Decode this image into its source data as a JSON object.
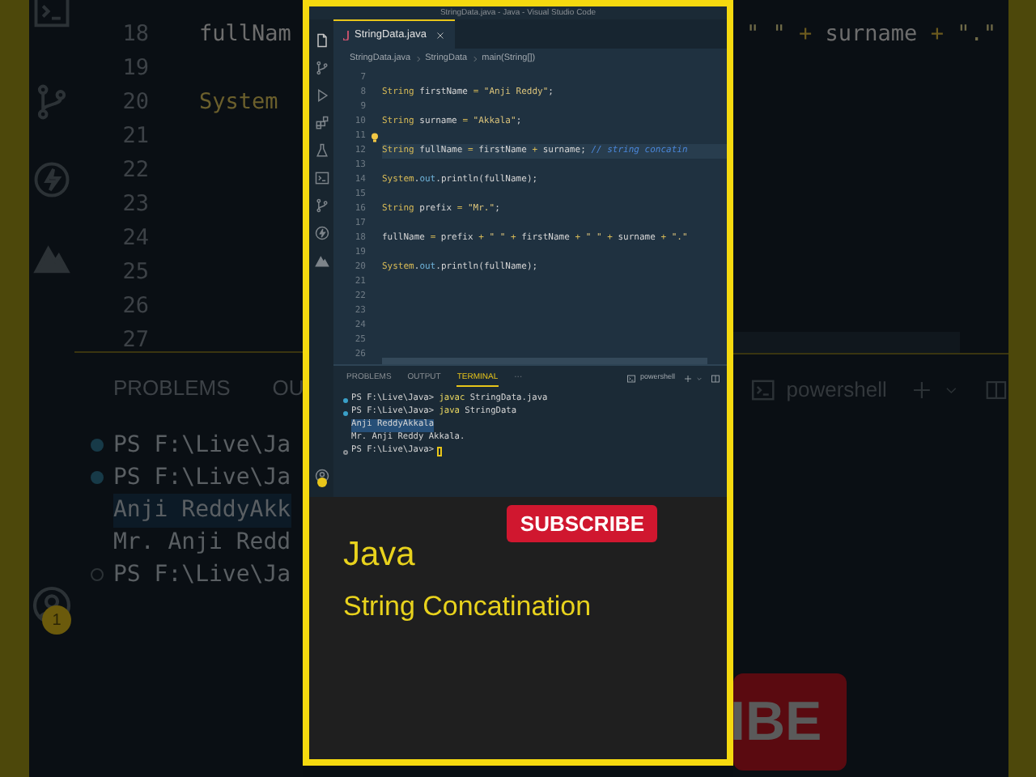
{
  "background": {
    "editor_rows": [
      {
        "number": "18",
        "left_text": "fullNam",
        "right_tokens": [
          {
            "kind": "str",
            "text": "\" \""
          },
          {
            "kind": "op",
            "text": " + "
          },
          {
            "kind": "var",
            "text": "surname"
          },
          {
            "kind": "op",
            "text": " + "
          },
          {
            "kind": "str",
            "text": "\".\""
          }
        ]
      },
      {
        "number": "19"
      },
      {
        "number": "20",
        "left_text": "System"
      },
      {
        "number": "21"
      },
      {
        "number": "22"
      },
      {
        "number": "23"
      },
      {
        "number": "24"
      },
      {
        "number": "25"
      },
      {
        "number": "26"
      },
      {
        "number": "27"
      }
    ],
    "panel_tabs": [
      "PROBLEMS",
      "OU"
    ],
    "shell_label": "powershell",
    "terminal_lines": [
      {
        "kind": "done",
        "text": "PS F:\\Live\\Ja"
      },
      {
        "kind": "done",
        "text": "PS F:\\Live\\Ja"
      },
      {
        "kind": "output",
        "text": "Anji ReddyAkk",
        "selected": true
      },
      {
        "kind": "output",
        "text": "Mr. Anji Redd",
        "selected": false
      },
      {
        "kind": "waiting",
        "text": "PS F:\\Live\\Ja"
      }
    ],
    "badge": "1",
    "subscribe_fragment": "IBE"
  },
  "window": {
    "title": "StringData.java - Java - Visual Studio Code"
  },
  "tabs": [
    {
      "label": "StringData.java",
      "selected": true
    }
  ],
  "breadcrumbs": [
    "StringData.java",
    "StringData",
    "main(String[])"
  ],
  "code_lines": [
    {
      "number": "7"
    },
    {
      "number": "8",
      "tokens": [
        {
          "kind": "type",
          "text": "String"
        },
        {
          "kind": "var",
          "text": " firstName "
        },
        {
          "kind": "op",
          "text": "="
        },
        {
          "kind": "str",
          "text": " \"Anji Reddy\""
        },
        {
          "kind": "punct",
          "text": ";"
        }
      ]
    },
    {
      "number": "9"
    },
    {
      "number": "10",
      "tokens": [
        {
          "kind": "type",
          "text": "String"
        },
        {
          "kind": "var",
          "text": " surname "
        },
        {
          "kind": "op",
          "text": "="
        },
        {
          "kind": "str",
          "text": " \"Akkala\""
        },
        {
          "kind": "punct",
          "text": ";"
        }
      ]
    },
    {
      "number": "11",
      "hint": true
    },
    {
      "number": "12",
      "current": true,
      "tokens": [
        {
          "kind": "type",
          "text": "String"
        },
        {
          "kind": "var",
          "text": " fullName "
        },
        {
          "kind": "op",
          "text": "="
        },
        {
          "kind": "var",
          "text": " firstName "
        },
        {
          "kind": "op",
          "text": "+"
        },
        {
          "kind": "var",
          "text": " surname"
        },
        {
          "kind": "punct",
          "text": "; "
        },
        {
          "kind": "comment",
          "text": "// string concatin"
        }
      ]
    },
    {
      "number": "13"
    },
    {
      "number": "14",
      "tokens": [
        {
          "kind": "cls",
          "text": "System"
        },
        {
          "kind": "punct",
          "text": "."
        },
        {
          "kind": "field",
          "text": "out"
        },
        {
          "kind": "punct",
          "text": "."
        },
        {
          "kind": "method",
          "text": "println"
        },
        {
          "kind": "punct",
          "text": "("
        },
        {
          "kind": "var",
          "text": "fullName"
        },
        {
          "kind": "punct",
          "text": ");"
        }
      ]
    },
    {
      "number": "15"
    },
    {
      "number": "16",
      "tokens": [
        {
          "kind": "type",
          "text": "String"
        },
        {
          "kind": "var",
          "text": " prefix "
        },
        {
          "kind": "op",
          "text": "="
        },
        {
          "kind": "str",
          "text": " \"Mr.\""
        },
        {
          "kind": "punct",
          "text": ";"
        }
      ]
    },
    {
      "number": "17"
    },
    {
      "number": "18",
      "tokens": [
        {
          "kind": "var",
          "text": "fullName "
        },
        {
          "kind": "op",
          "text": "="
        },
        {
          "kind": "var",
          "text": " prefix "
        },
        {
          "kind": "op",
          "text": "+"
        },
        {
          "kind": "str",
          "text": " \" \" "
        },
        {
          "kind": "op",
          "text": "+"
        },
        {
          "kind": "var",
          "text": " firstName "
        },
        {
          "kind": "op",
          "text": "+"
        },
        {
          "kind": "str",
          "text": " \" \" "
        },
        {
          "kind": "op",
          "text": "+"
        },
        {
          "kind": "var",
          "text": " surname "
        },
        {
          "kind": "op",
          "text": "+"
        },
        {
          "kind": "str",
          "text": " \".\""
        }
      ]
    },
    {
      "number": "19"
    },
    {
      "number": "20",
      "tokens": [
        {
          "kind": "cls",
          "text": "System"
        },
        {
          "kind": "punct",
          "text": "."
        },
        {
          "kind": "field",
          "text": "out"
        },
        {
          "kind": "punct",
          "text": "."
        },
        {
          "kind": "method",
          "text": "println"
        },
        {
          "kind": "punct",
          "text": "("
        },
        {
          "kind": "var",
          "text": "fullName"
        },
        {
          "kind": "punct",
          "text": ");"
        }
      ]
    },
    {
      "number": "21"
    },
    {
      "number": "22"
    },
    {
      "number": "23"
    },
    {
      "number": "24"
    },
    {
      "number": "25"
    },
    {
      "number": "26"
    }
  ],
  "panel_tabs": [
    {
      "label": "PROBLEMS",
      "selected": false
    },
    {
      "label": "OUTPUT",
      "selected": false
    },
    {
      "label": "TERMINAL",
      "selected": true
    },
    {
      "label": "···",
      "selected": false
    }
  ],
  "shell_label": "powershell",
  "terminal_lines": [
    {
      "kind": "done",
      "prompt": "PS F:\\Live\\Java>",
      "command": "javac",
      "args": "StringData.java"
    },
    {
      "kind": "done",
      "prompt": "PS F:\\Live\\Java>",
      "command": "java",
      "args": "StringData"
    },
    {
      "kind": "output",
      "text": "Anji ReddyAkkala",
      "selected": true
    },
    {
      "kind": "output",
      "text": "Mr. Anji Reddy Akkala.",
      "selected": false
    },
    {
      "kind": "waiting",
      "prompt": "PS F:\\Live\\Java>",
      "cursor": true
    }
  ],
  "subscribe_button": "SUBSCRIBE",
  "video_title": "Java",
  "video_subtitle": "String Concatination"
}
